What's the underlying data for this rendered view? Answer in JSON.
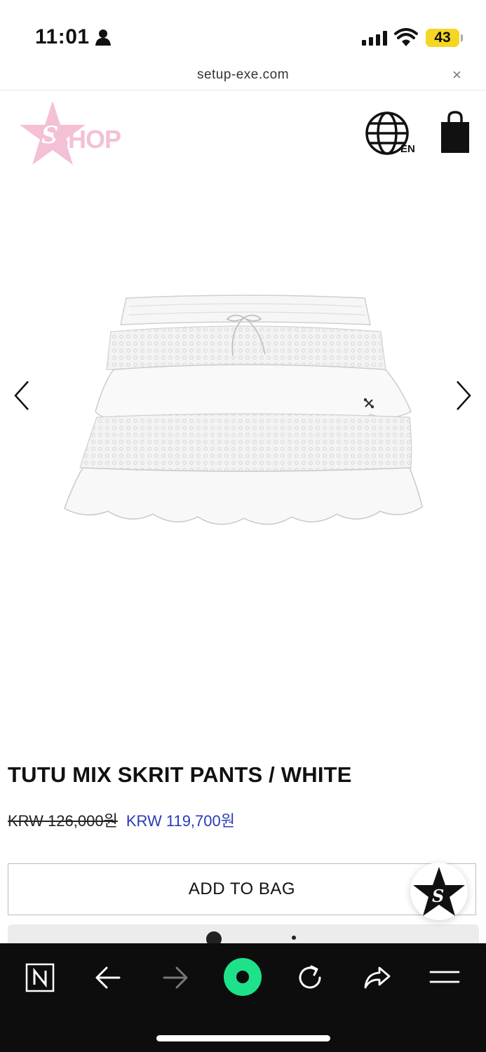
{
  "status_bar": {
    "time": "11:01",
    "battery": "43"
  },
  "browser": {
    "url": "setup-exe.com",
    "close_glyph": "×"
  },
  "header": {
    "logo_text": "SHOP",
    "language": "EN"
  },
  "product": {
    "title": "TUTU MIX SKRIT PANTS / WHITE",
    "original_price": "KRW 126,000원",
    "sale_price": "KRW 119,700원",
    "add_to_bag_label": "ADD TO BAG"
  },
  "icons": {
    "carousel_prev": "chevron-left-icon",
    "carousel_next": "chevron-right-icon",
    "globe": "globe-icon",
    "bag": "shopping-bag-icon",
    "toolbar": [
      "n-logo-icon",
      "back-arrow-icon",
      "forward-arrow-icon",
      "green-dot-icon",
      "reload-icon",
      "share-icon",
      "menu-icon"
    ]
  },
  "colors": {
    "logo_pink": "#f4c0d6",
    "sale_blue": "#2a3bb5",
    "toolbar_bg": "#0d0d0d",
    "battery_yellow": "#f5d623",
    "green_button": "#1ee28a"
  }
}
